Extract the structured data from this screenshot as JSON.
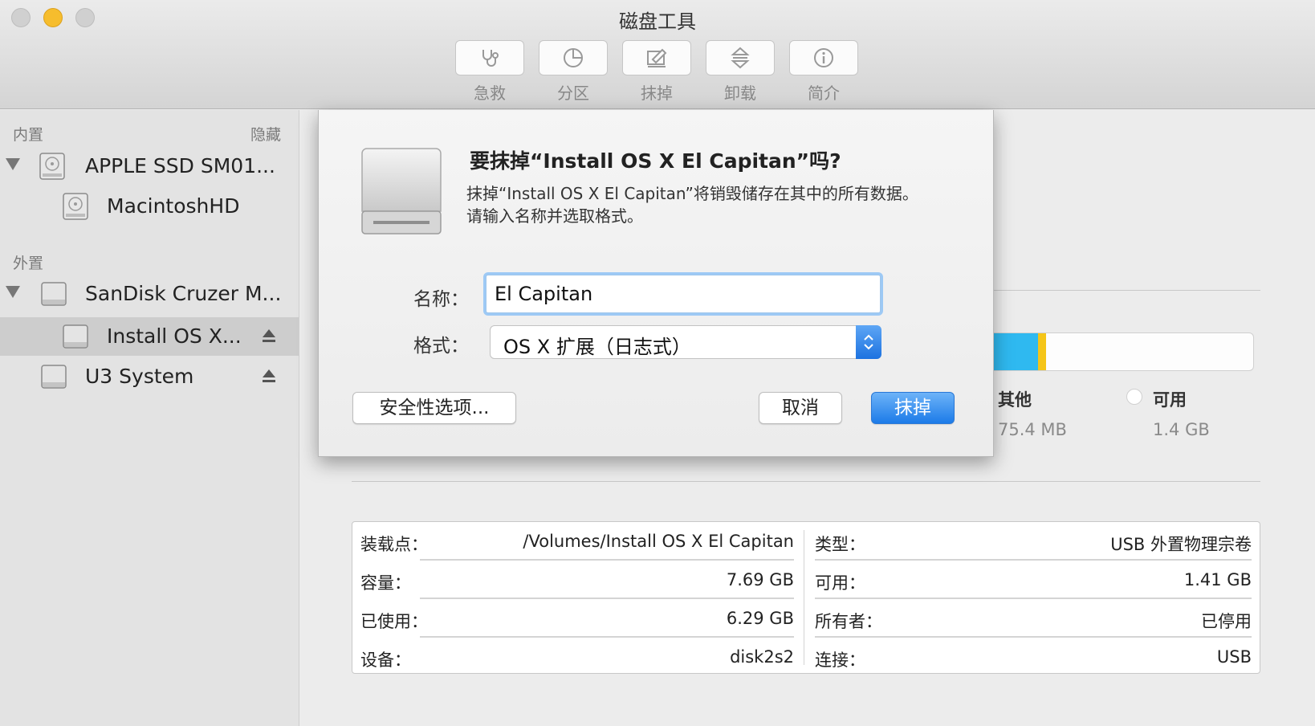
{
  "window": {
    "title": "磁盘工具"
  },
  "toolbar": {
    "items": [
      {
        "label": "急救",
        "icon": "stethoscope-icon"
      },
      {
        "label": "分区",
        "icon": "pie-chart-icon"
      },
      {
        "label": "抹掉",
        "icon": "eraser-icon"
      },
      {
        "label": "卸载",
        "icon": "unmount-icon"
      },
      {
        "label": "简介",
        "icon": "info-icon"
      }
    ]
  },
  "sidebar": {
    "internal_label": "内置",
    "hide_label": "隐藏",
    "external_label": "外置",
    "items": [
      {
        "label": "APPLE SSD SM01..."
      },
      {
        "label": "MacintoshHD"
      },
      {
        "label": "SanDisk Cruzer M..."
      },
      {
        "label": "Install OS X..."
      },
      {
        "label": "U3 System"
      }
    ]
  },
  "usage": {
    "other_title": "其他",
    "other_value": "75.4 MB",
    "free_title": "可用",
    "free_value": "1.4 GB",
    "colors": {
      "used": "#2fb9f0",
      "other": "#f5c518",
      "free": "#ffffff"
    }
  },
  "info": {
    "left": [
      {
        "key": "装载点：",
        "value": "/Volumes/Install OS X El Capitan"
      },
      {
        "key": "容量：",
        "value": "7.69 GB"
      },
      {
        "key": "已使用：",
        "value": "6.29 GB"
      },
      {
        "key": "设备：",
        "value": "disk2s2"
      }
    ],
    "right": [
      {
        "key": "类型：",
        "value": "USB 外置物理宗卷"
      },
      {
        "key": "可用：",
        "value": "1.41 GB"
      },
      {
        "key": "所有者：",
        "value": "已停用"
      },
      {
        "key": "连接：",
        "value": "USB"
      }
    ]
  },
  "dialog": {
    "title": "要抹掉“Install OS X El Capitan”吗?",
    "message_line1": "抹掉“Install OS X El Capitan”将销毁储存在其中的所有数据。",
    "message_line2": "请输入名称并选取格式。",
    "name_label": "名称：",
    "name_value": "El Capitan",
    "format_label": "格式：",
    "format_value": "OS X 扩展（日志式）",
    "security_button": "安全性选项...",
    "cancel_button": "取消",
    "erase_button": "抹掉",
    "accent_color": "#1c7be8"
  }
}
